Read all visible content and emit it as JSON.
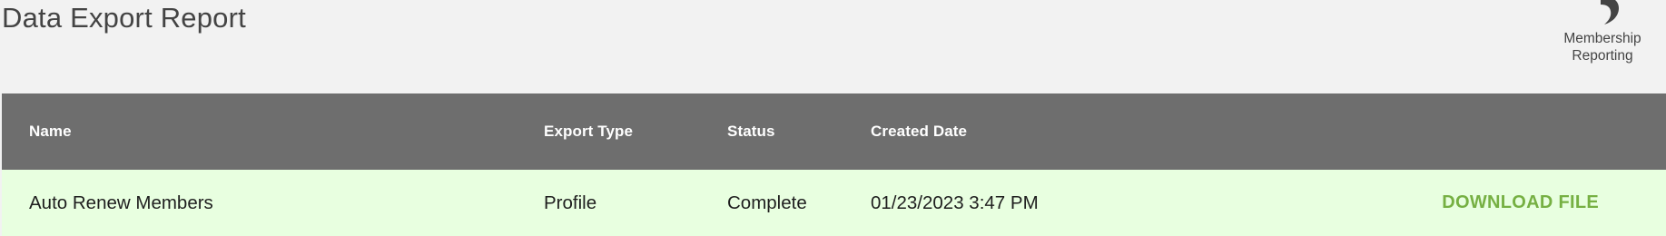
{
  "page": {
    "title": "Data Export Report"
  },
  "back_link": {
    "label_line1": "Membership",
    "label_line2": "Reporting",
    "icon": "undo-arrow-icon"
  },
  "table": {
    "columns": [
      "Name",
      "Export Type",
      "Status",
      "Created Date"
    ],
    "rows": [
      {
        "name": "Auto Renew Members",
        "export_type": "Profile",
        "status": "Complete",
        "created_date": "01/23/2023 3:47 PM",
        "action": "DOWNLOAD FILE"
      }
    ]
  },
  "colors": {
    "header_bg": "#6e6e6e",
    "row_bg": "#e8ffe0",
    "action": "#76b043",
    "page_bg": "#f2f2f2"
  }
}
